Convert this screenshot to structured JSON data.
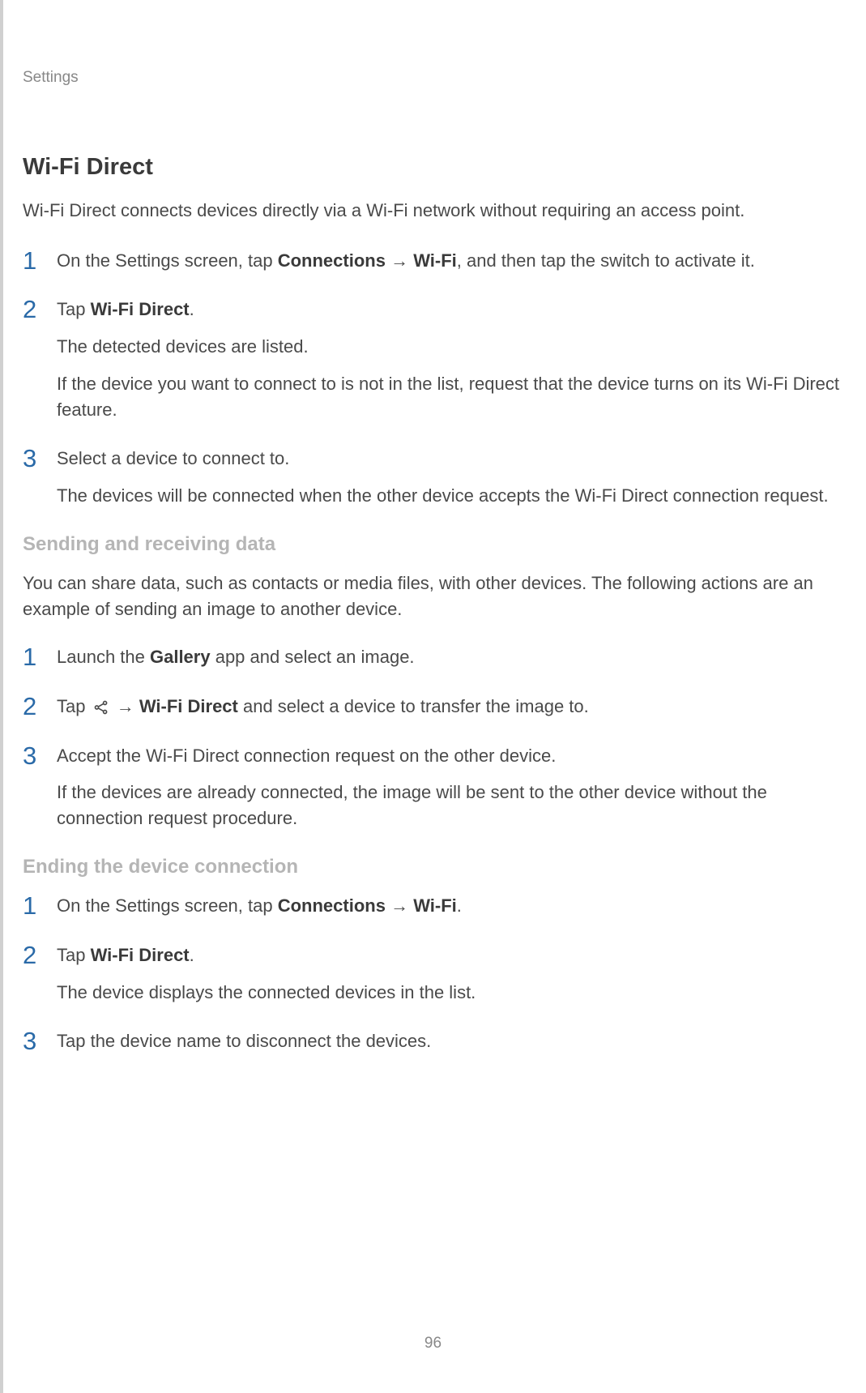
{
  "header": {
    "label": "Settings"
  },
  "main": {
    "title": "Wi-Fi Direct",
    "intro": "Wi-Fi Direct connects devices directly via a Wi-Fi network without requiring an access point.",
    "steps_primary": [
      {
        "num": "1",
        "parts": [
          {
            "t": "On the Settings screen, tap "
          },
          {
            "t": "Connections",
            "bold": true
          },
          {
            "t": " → "
          },
          {
            "t": "Wi-Fi",
            "bold": true
          },
          {
            "t": ", and then tap the switch to activate it."
          }
        ]
      },
      {
        "num": "2",
        "parts": [
          {
            "t": "Tap "
          },
          {
            "t": "Wi-Fi Direct",
            "bold": true
          },
          {
            "t": "."
          }
        ],
        "extra": [
          "The detected devices are listed.",
          "If the device you want to connect to is not in the list, request that the device turns on its Wi-Fi Direct feature."
        ]
      },
      {
        "num": "3",
        "parts": [
          {
            "t": "Select a device to connect to."
          }
        ],
        "extra": [
          "The devices will be connected when the other device accepts the Wi-Fi Direct connection request."
        ]
      }
    ],
    "section1": {
      "heading": "Sending and receiving data",
      "intro": "You can share data, such as contacts or media files, with other devices. The following actions are an example of sending an image to another device.",
      "steps": [
        {
          "num": "1",
          "parts": [
            {
              "t": "Launch the "
            },
            {
              "t": "Gallery",
              "bold": true
            },
            {
              "t": " app and select an image."
            }
          ]
        },
        {
          "num": "2",
          "parts": [
            {
              "t": "Tap "
            },
            {
              "icon": "share"
            },
            {
              "t": " → "
            },
            {
              "t": "Wi-Fi Direct",
              "bold": true
            },
            {
              "t": " and select a device to transfer the image to."
            }
          ]
        },
        {
          "num": "3",
          "parts": [
            {
              "t": "Accept the Wi-Fi Direct connection request on the other device."
            }
          ],
          "extra": [
            "If the devices are already connected, the image will be sent to the other device without the connection request procedure."
          ]
        }
      ]
    },
    "section2": {
      "heading": "Ending the device connection",
      "steps": [
        {
          "num": "1",
          "parts": [
            {
              "t": "On the Settings screen, tap "
            },
            {
              "t": "Connections",
              "bold": true
            },
            {
              "t": " → "
            },
            {
              "t": "Wi-Fi",
              "bold": true
            },
            {
              "t": "."
            }
          ]
        },
        {
          "num": "2",
          "parts": [
            {
              "t": "Tap "
            },
            {
              "t": "Wi-Fi Direct",
              "bold": true
            },
            {
              "t": "."
            }
          ],
          "extra": [
            "The device displays the connected devices in the list."
          ]
        },
        {
          "num": "3",
          "parts": [
            {
              "t": "Tap the device name to disconnect the devices."
            }
          ]
        }
      ]
    }
  },
  "page_number": "96"
}
